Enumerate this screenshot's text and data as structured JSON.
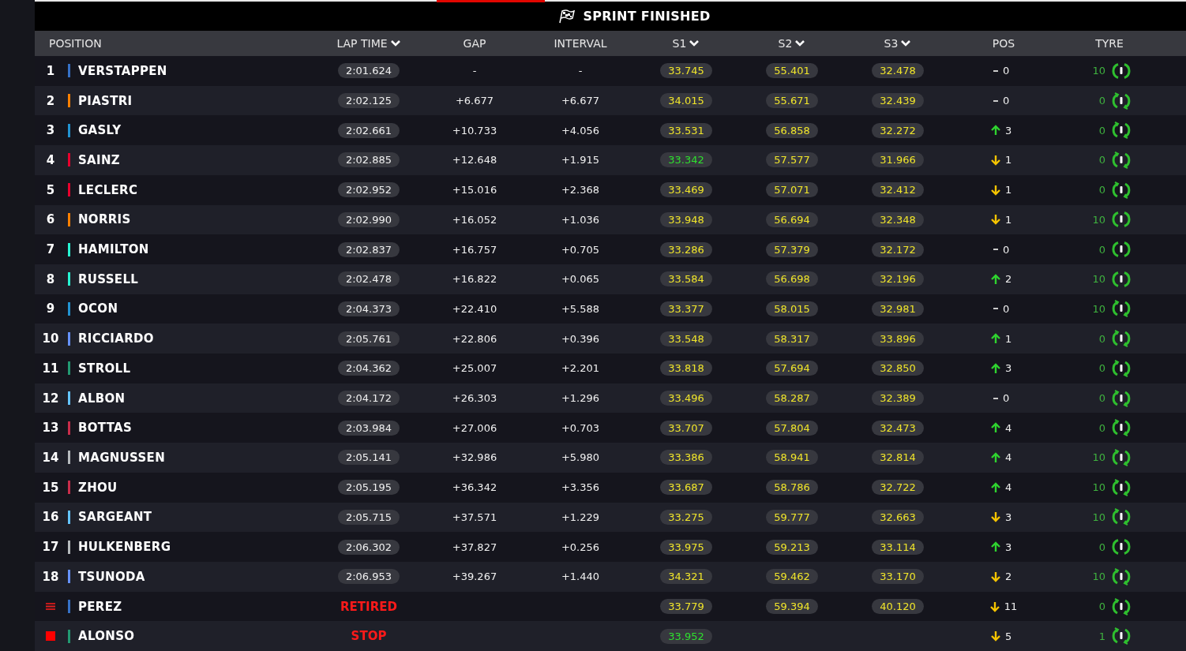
{
  "banner": {
    "title": "SPRINT FINISHED"
  },
  "columns": [
    {
      "label": "POSITION",
      "sortable": false
    },
    {
      "label": "LAP TIME",
      "sortable": true
    },
    {
      "label": "GAP",
      "sortable": false
    },
    {
      "label": "INTERVAL",
      "sortable": false
    },
    {
      "label": "S1",
      "sortable": true
    },
    {
      "label": "S2",
      "sortable": true
    },
    {
      "label": "S3",
      "sortable": true
    },
    {
      "label": "POS",
      "sortable": false
    },
    {
      "label": "TYRE",
      "sortable": false
    }
  ],
  "rows": [
    {
      "position": {
        "kind": "number",
        "text": "1"
      },
      "driver": "VERSTAPPEN",
      "color": "#3671c6",
      "lap": {
        "kind": "time",
        "text": "2:01.624"
      },
      "gap": "-",
      "interval": "-",
      "sectors": [
        {
          "time": "33.745",
          "fastest": false
        },
        {
          "time": "55.401",
          "fastest": false
        },
        {
          "time": "32.478",
          "fastest": false
        }
      ],
      "change": {
        "kind": "same",
        "text": "0"
      },
      "tyre": {
        "laps": "10",
        "fresh": false
      }
    },
    {
      "position": {
        "kind": "number",
        "text": "2"
      },
      "driver": "PIASTRI",
      "color": "#ff8000",
      "lap": {
        "kind": "time",
        "text": "2:02.125"
      },
      "gap": "+6.677",
      "interval": "+6.677",
      "sectors": [
        {
          "time": "34.015",
          "fastest": false
        },
        {
          "time": "55.671",
          "fastest": false
        },
        {
          "time": "32.439",
          "fastest": false
        }
      ],
      "change": {
        "kind": "same",
        "text": "0"
      },
      "tyre": {
        "laps": "0",
        "fresh": true
      }
    },
    {
      "position": {
        "kind": "number",
        "text": "3"
      },
      "driver": "GASLY",
      "color": "#2293d1",
      "lap": {
        "kind": "time",
        "text": "2:02.661"
      },
      "gap": "+10.733",
      "interval": "+4.056",
      "sectors": [
        {
          "time": "33.531",
          "fastest": false
        },
        {
          "time": "56.858",
          "fastest": false
        },
        {
          "time": "32.272",
          "fastest": false
        }
      ],
      "change": {
        "kind": "up",
        "text": "3"
      },
      "tyre": {
        "laps": "0",
        "fresh": true
      }
    },
    {
      "position": {
        "kind": "number",
        "text": "4"
      },
      "driver": "SAINZ",
      "color": "#e8002d",
      "lap": {
        "kind": "time",
        "text": "2:02.885"
      },
      "gap": "+12.648",
      "interval": "+1.915",
      "sectors": [
        {
          "time": "33.342",
          "fastest": true
        },
        {
          "time": "57.577",
          "fastest": false
        },
        {
          "time": "31.966",
          "fastest": false
        }
      ],
      "change": {
        "kind": "down",
        "text": "1"
      },
      "tyre": {
        "laps": "0",
        "fresh": true
      }
    },
    {
      "position": {
        "kind": "number",
        "text": "5"
      },
      "driver": "LECLERC",
      "color": "#e8002d",
      "lap": {
        "kind": "time",
        "text": "2:02.952"
      },
      "gap": "+15.016",
      "interval": "+2.368",
      "sectors": [
        {
          "time": "33.469",
          "fastest": false
        },
        {
          "time": "57.071",
          "fastest": false
        },
        {
          "time": "32.412",
          "fastest": false
        }
      ],
      "change": {
        "kind": "down",
        "text": "1"
      },
      "tyre": {
        "laps": "0",
        "fresh": true
      }
    },
    {
      "position": {
        "kind": "number",
        "text": "6"
      },
      "driver": "NORRIS",
      "color": "#ff8000",
      "lap": {
        "kind": "time",
        "text": "2:02.990"
      },
      "gap": "+16.052",
      "interval": "+1.036",
      "sectors": [
        {
          "time": "33.948",
          "fastest": false
        },
        {
          "time": "56.694",
          "fastest": false
        },
        {
          "time": "32.348",
          "fastest": false
        }
      ],
      "change": {
        "kind": "down",
        "text": "1"
      },
      "tyre": {
        "laps": "10",
        "fresh": false
      }
    },
    {
      "position": {
        "kind": "number",
        "text": "7"
      },
      "driver": "HAMILTON",
      "color": "#27f4d2",
      "lap": {
        "kind": "time",
        "text": "2:02.837"
      },
      "gap": "+16.757",
      "interval": "+0.705",
      "sectors": [
        {
          "time": "33.286",
          "fastest": false
        },
        {
          "time": "57.379",
          "fastest": false
        },
        {
          "time": "32.172",
          "fastest": false
        }
      ],
      "change": {
        "kind": "same",
        "text": "0"
      },
      "tyre": {
        "laps": "0",
        "fresh": false
      }
    },
    {
      "position": {
        "kind": "number",
        "text": "8"
      },
      "driver": "RUSSELL",
      "color": "#27f4d2",
      "lap": {
        "kind": "time",
        "text": "2:02.478"
      },
      "gap": "+16.822",
      "interval": "+0.065",
      "sectors": [
        {
          "time": "33.584",
          "fastest": false
        },
        {
          "time": "56.698",
          "fastest": false
        },
        {
          "time": "32.196",
          "fastest": false
        }
      ],
      "change": {
        "kind": "up",
        "text": "2"
      },
      "tyre": {
        "laps": "10",
        "fresh": false
      }
    },
    {
      "position": {
        "kind": "number",
        "text": "9"
      },
      "driver": "OCON",
      "color": "#2293d1",
      "lap": {
        "kind": "time",
        "text": "2:04.373"
      },
      "gap": "+22.410",
      "interval": "+5.588",
      "sectors": [
        {
          "time": "33.377",
          "fastest": false
        },
        {
          "time": "58.015",
          "fastest": false
        },
        {
          "time": "32.981",
          "fastest": false
        }
      ],
      "change": {
        "kind": "same",
        "text": "0"
      },
      "tyre": {
        "laps": "10",
        "fresh": true
      }
    },
    {
      "position": {
        "kind": "number",
        "text": "10"
      },
      "driver": "RICCIARDO",
      "color": "#6692ff",
      "lap": {
        "kind": "time",
        "text": "2:05.761"
      },
      "gap": "+22.806",
      "interval": "+0.396",
      "sectors": [
        {
          "time": "33.548",
          "fastest": false
        },
        {
          "time": "58.317",
          "fastest": false
        },
        {
          "time": "33.896",
          "fastest": false
        }
      ],
      "change": {
        "kind": "up",
        "text": "1"
      },
      "tyre": {
        "laps": "0",
        "fresh": true
      }
    },
    {
      "position": {
        "kind": "number",
        "text": "11"
      },
      "driver": "STROLL",
      "color": "#229971",
      "lap": {
        "kind": "time",
        "text": "2:04.362"
      },
      "gap": "+25.007",
      "interval": "+2.201",
      "sectors": [
        {
          "time": "33.818",
          "fastest": false
        },
        {
          "time": "57.694",
          "fastest": false
        },
        {
          "time": "32.850",
          "fastest": false
        }
      ],
      "change": {
        "kind": "up",
        "text": "3"
      },
      "tyre": {
        "laps": "0",
        "fresh": true
      }
    },
    {
      "position": {
        "kind": "number",
        "text": "12"
      },
      "driver": "ALBON",
      "color": "#64c4ff",
      "lap": {
        "kind": "time",
        "text": "2:04.172"
      },
      "gap": "+26.303",
      "interval": "+1.296",
      "sectors": [
        {
          "time": "33.496",
          "fastest": false
        },
        {
          "time": "58.287",
          "fastest": false
        },
        {
          "time": "32.389",
          "fastest": false
        }
      ],
      "change": {
        "kind": "same",
        "text": "0"
      },
      "tyre": {
        "laps": "0",
        "fresh": true
      }
    },
    {
      "position": {
        "kind": "number",
        "text": "13"
      },
      "driver": "BOTTAS",
      "color": "#c92d4b",
      "lap": {
        "kind": "time",
        "text": "2:03.984"
      },
      "gap": "+27.006",
      "interval": "+0.703",
      "sectors": [
        {
          "time": "33.707",
          "fastest": false
        },
        {
          "time": "57.804",
          "fastest": false
        },
        {
          "time": "32.473",
          "fastest": false
        }
      ],
      "change": {
        "kind": "up",
        "text": "4"
      },
      "tyre": {
        "laps": "0",
        "fresh": true
      }
    },
    {
      "position": {
        "kind": "number",
        "text": "14"
      },
      "driver": "MAGNUSSEN",
      "color": "#b6babd",
      "lap": {
        "kind": "time",
        "text": "2:05.141"
      },
      "gap": "+32.986",
      "interval": "+5.980",
      "sectors": [
        {
          "time": "33.386",
          "fastest": false
        },
        {
          "time": "58.941",
          "fastest": false
        },
        {
          "time": "32.814",
          "fastest": false
        }
      ],
      "change": {
        "kind": "up",
        "text": "4"
      },
      "tyre": {
        "laps": "10",
        "fresh": true
      }
    },
    {
      "position": {
        "kind": "number",
        "text": "15"
      },
      "driver": "ZHOU",
      "color": "#c92d4b",
      "lap": {
        "kind": "time",
        "text": "2:05.195"
      },
      "gap": "+36.342",
      "interval": "+3.356",
      "sectors": [
        {
          "time": "33.687",
          "fastest": false
        },
        {
          "time": "58.786",
          "fastest": false
        },
        {
          "time": "32.722",
          "fastest": false
        }
      ],
      "change": {
        "kind": "up",
        "text": "4"
      },
      "tyre": {
        "laps": "10",
        "fresh": true
      }
    },
    {
      "position": {
        "kind": "number",
        "text": "16"
      },
      "driver": "SARGEANT",
      "color": "#64c4ff",
      "lap": {
        "kind": "time",
        "text": "2:05.715"
      },
      "gap": "+37.571",
      "interval": "+1.229",
      "sectors": [
        {
          "time": "33.275",
          "fastest": false
        },
        {
          "time": "59.777",
          "fastest": false
        },
        {
          "time": "32.663",
          "fastest": false
        }
      ],
      "change": {
        "kind": "down",
        "text": "3"
      },
      "tyre": {
        "laps": "10",
        "fresh": true
      }
    },
    {
      "position": {
        "kind": "number",
        "text": "17"
      },
      "driver": "HULKENBERG",
      "color": "#b6babd",
      "lap": {
        "kind": "time",
        "text": "2:06.302"
      },
      "gap": "+37.827",
      "interval": "+0.256",
      "sectors": [
        {
          "time": "33.975",
          "fastest": false
        },
        {
          "time": "59.213",
          "fastest": false
        },
        {
          "time": "33.114",
          "fastest": false
        }
      ],
      "change": {
        "kind": "up",
        "text": "3"
      },
      "tyre": {
        "laps": "0",
        "fresh": false
      }
    },
    {
      "position": {
        "kind": "number",
        "text": "18"
      },
      "driver": "TSUNODA",
      "color": "#6692ff",
      "lap": {
        "kind": "time",
        "text": "2:06.953"
      },
      "gap": "+39.267",
      "interval": "+1.440",
      "sectors": [
        {
          "time": "34.321",
          "fastest": false
        },
        {
          "time": "59.462",
          "fastest": false
        },
        {
          "time": "33.170",
          "fastest": false
        }
      ],
      "change": {
        "kind": "down",
        "text": "2"
      },
      "tyre": {
        "laps": "10",
        "fresh": true
      }
    },
    {
      "position": {
        "kind": "retired"
      },
      "driver": "PEREZ",
      "color": "#3671c6",
      "lap": {
        "kind": "status",
        "text": "RETIRED"
      },
      "sectors": [
        {
          "time": "33.779",
          "fastest": false
        },
        {
          "time": "59.394",
          "fastest": false
        },
        {
          "time": "40.120",
          "fastest": false
        }
      ],
      "change": {
        "kind": "down",
        "text": "11"
      },
      "tyre": {
        "laps": "0",
        "fresh": true
      }
    },
    {
      "position": {
        "kind": "stopped"
      },
      "driver": "ALONSO",
      "color": "#229971",
      "lap": {
        "kind": "status",
        "text": "STOP"
      },
      "sectors": [
        {
          "time": "33.952",
          "fastest": true
        }
      ],
      "change": {
        "kind": "down",
        "text": "5"
      },
      "tyre": {
        "laps": "1",
        "fresh": true
      }
    }
  ]
}
